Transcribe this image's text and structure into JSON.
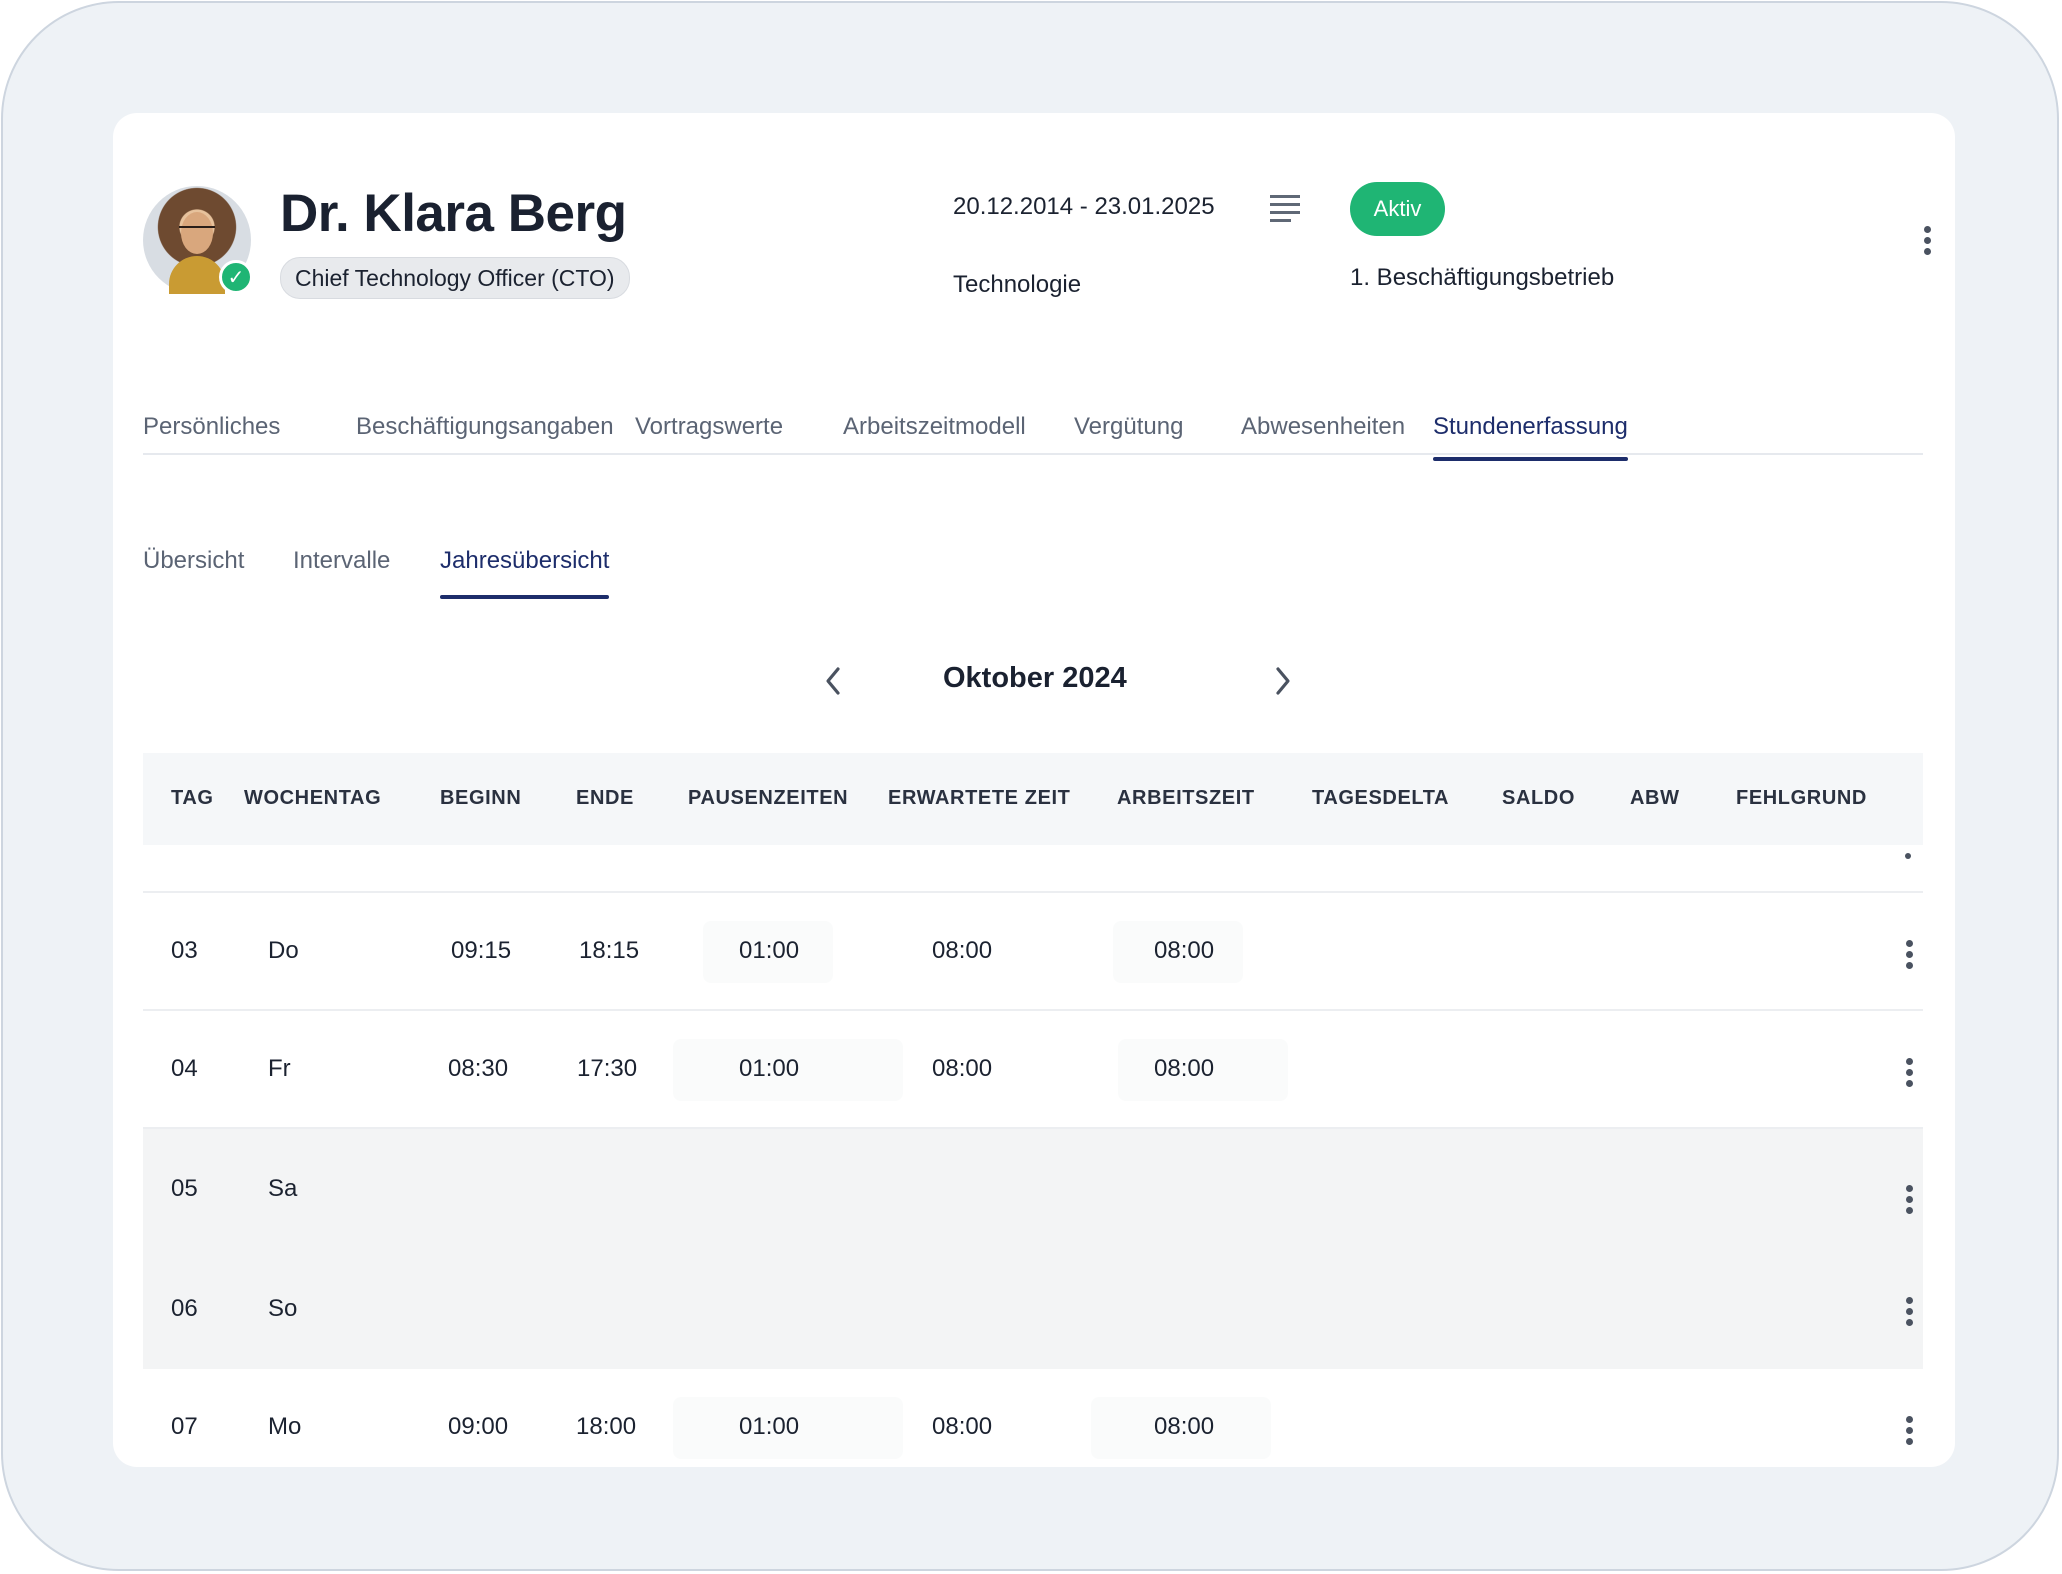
{
  "employee": {
    "name": "Dr. Klara Berg",
    "role": "Chief Technology Officer (CTO)",
    "date_range": "20.12.2014 - 23.01.2025",
    "status": "Aktiv",
    "department": "Technologie",
    "company": "1. Beschäftigungsbetrieb"
  },
  "colors": {
    "accent": "#1d2d6b",
    "status_green": "#1fb574"
  },
  "main_tabs": [
    {
      "label": "Persönliches",
      "active": false
    },
    {
      "label": "Beschäftigungsangaben",
      "active": false
    },
    {
      "label": "Vortragswerte",
      "active": false
    },
    {
      "label": "Arbeitszeitmodell",
      "active": false
    },
    {
      "label": "Vergütung",
      "active": false
    },
    {
      "label": "Abwesenheiten",
      "active": false
    },
    {
      "label": "Stundenerfassung",
      "active": true
    }
  ],
  "sub_tabs": [
    {
      "label": "Übersicht",
      "active": false
    },
    {
      "label": "Intervalle",
      "active": false
    },
    {
      "label": "Jahresübersicht",
      "active": true
    }
  ],
  "month": {
    "title": "Oktober 2024",
    "prev_icon": "chevron-left-icon",
    "next_icon": "chevron-right-icon"
  },
  "table": {
    "columns": [
      "TAG",
      "WOCHENTAG",
      "BEGINN",
      "ENDE",
      "PAUSENZEITEN",
      "ERWARTETE ZEIT",
      "ARBEITSZEIT",
      "TAGESDELTA",
      "SALDO",
      "ABW",
      "FEHLGRUND"
    ],
    "rows": [
      {
        "tag": "03",
        "wochentag": "Do",
        "beginn": "09:15",
        "ende": "18:15",
        "pausen": "01:00",
        "erwartet": "08:00",
        "arbeitszeit": "08:00",
        "weekend": false
      },
      {
        "tag": "04",
        "wochentag": "Fr",
        "beginn": "08:30",
        "ende": "17:30",
        "pausen": "01:00",
        "erwartet": "08:00",
        "arbeitszeit": "08:00",
        "weekend": false
      },
      {
        "tag": "05",
        "wochentag": "Sa",
        "beginn": "",
        "ende": "",
        "pausen": "",
        "erwartet": "",
        "arbeitszeit": "",
        "weekend": true
      },
      {
        "tag": "06",
        "wochentag": "So",
        "beginn": "",
        "ende": "",
        "pausen": "",
        "erwartet": "",
        "arbeitszeit": "",
        "weekend": true
      },
      {
        "tag": "07",
        "wochentag": "Mo",
        "beginn": "09:00",
        "ende": "18:00",
        "pausen": "01:00",
        "erwartet": "08:00",
        "arbeitszeit": "08:00",
        "weekend": false
      }
    ]
  }
}
